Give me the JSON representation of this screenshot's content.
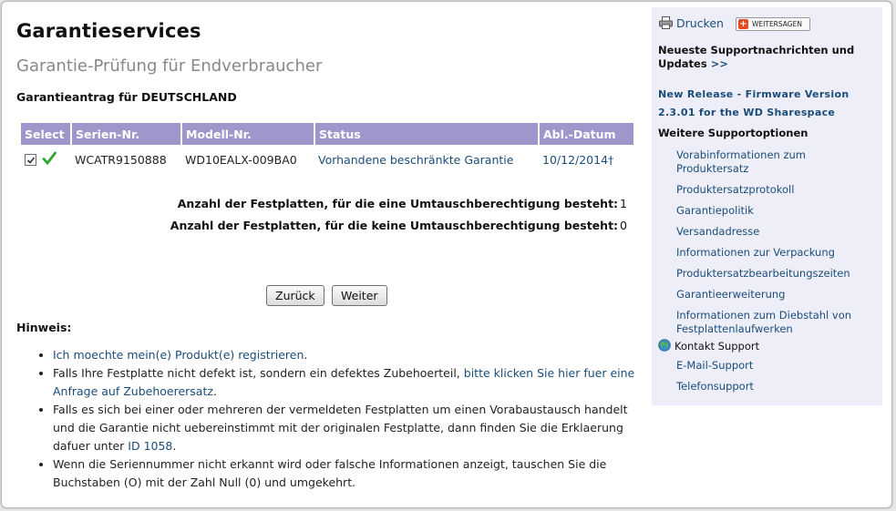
{
  "page": {
    "title": "Garantieservices",
    "subtitle": "Garantie-Prüfung für Endverbraucher",
    "country_heading": "Garantieantrag für DEUTSCHLAND"
  },
  "table": {
    "headers": [
      "Select",
      "Serien-Nr.",
      "Modell-Nr.",
      "Status",
      "Abl.-Datum"
    ],
    "rows": [
      {
        "checked": true,
        "serial": "WCATR9150888",
        "model": "WD10EALX-009BA0",
        "status": "Vorhandene beschränkte Garantie",
        "expiry": "10/12/2014†"
      }
    ]
  },
  "counts": {
    "eligible_label": "Anzahl der Festplatten, für die eine Umtauschberechtigung besteht:",
    "eligible_value": "1",
    "ineligible_label": "Anzahl der Festplatten, für die keine Umtauschberechtigung besteht:",
    "ineligible_value": "0"
  },
  "buttons": {
    "back": "Zurück",
    "next": "Weiter"
  },
  "notes": {
    "label": "Hinweis:",
    "item1_link": "Ich moechte mein(e) Produkt(e) registrieren",
    "item1_suffix": ".",
    "item2_prefix": "Falls Ihre Festplatte nicht defekt ist, sondern ein defektes Zubehoerteil, ",
    "item2_link": "bitte klicken Sie hier fuer eine Anfrage auf Zubehoerersatz",
    "item2_suffix": ".",
    "item3_prefix": "Falls es sich bei einer oder mehreren der vermeldeten Festplatten um einen Vorabaustausch handelt und die Garantie nicht uebereinstimmt mit der originalen Festplatte, dann finden Sie die Erklaerung dafuer unter ",
    "item3_link": "ID 1058",
    "item3_suffix": ".",
    "item4": "Wenn die Seriennummer nicht erkannt wird oder falsche Informationen anzeigt, tauschen Sie die Buchstaben (O) mit der Zahl Null (0) und umgekehrt."
  },
  "sidebar": {
    "print_label": "Drucken",
    "share_label": "WEITERSAGEN",
    "news_heading_line1": "Neueste Supportnachrichten und",
    "news_heading_line2": "Updates",
    "news_arrow": ">>",
    "release_line1": "New Release - Firmware Version",
    "release_line2": "2.3.01 for the WD Sharespace",
    "options_heading": "Weitere Supportoptionen",
    "links": [
      "Vorabinformationen zum Produktersatz",
      "Produktersatzprotokoll",
      "Garantiepolitik",
      "Versandadresse",
      "Informationen zur Verpackung",
      "Produktersatzbearbeitungszeiten",
      "Garantieerweiterung",
      "Informationen zum Diebstahl von Festplattenlaufwerken"
    ],
    "contact_heading": "Kontakt Support",
    "contact_links": [
      "E-Mail-Support",
      "Telefonsupport"
    ]
  },
  "colors": {
    "table_header": "#9d97cb",
    "link": "#1a4d7a",
    "sidebar_bg": "#eeeef8"
  }
}
